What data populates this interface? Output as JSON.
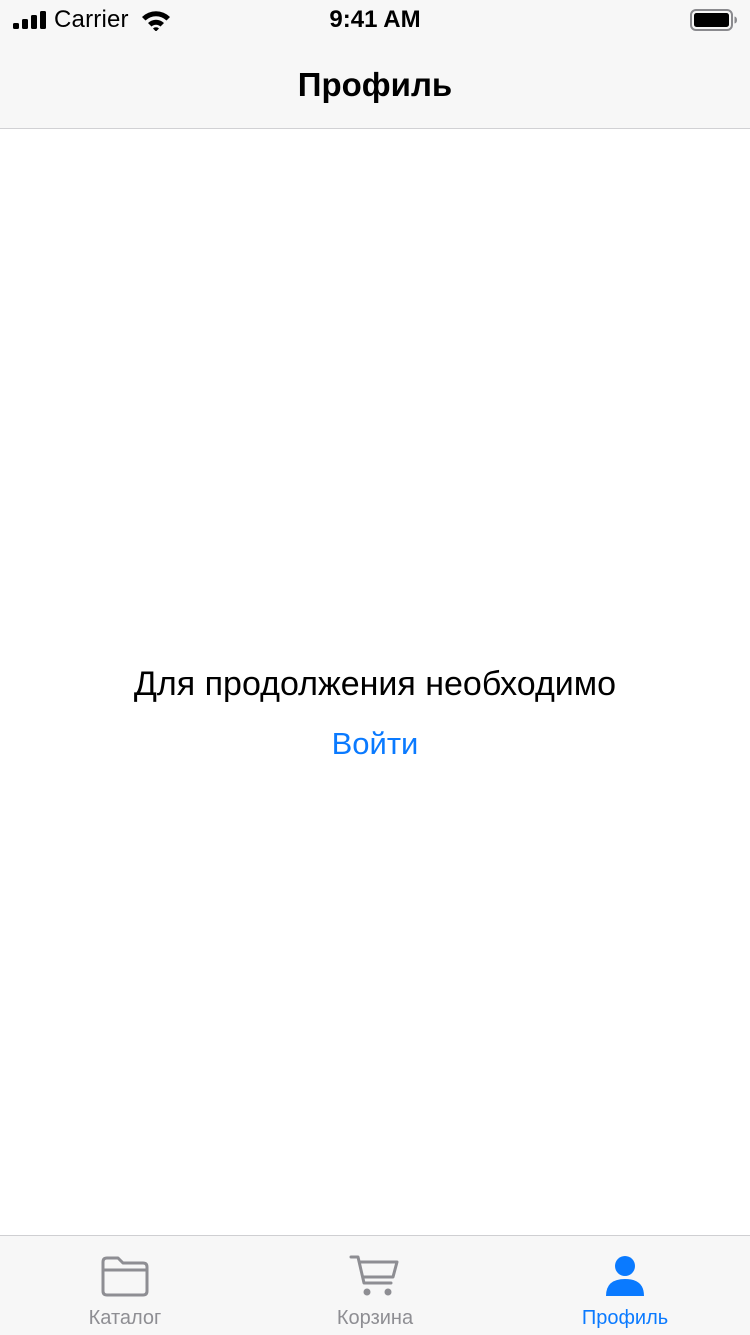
{
  "status_bar": {
    "carrier": "Carrier",
    "time": "9:41 AM",
    "icons": [
      "signal-icon",
      "wifi-icon",
      "battery-icon"
    ]
  },
  "nav": {
    "title": "Профиль"
  },
  "content": {
    "message": "Для продолжения необходимо",
    "login_label": "Войти"
  },
  "tab_bar": {
    "tabs": [
      {
        "label": "Каталог",
        "icon": "folder-icon",
        "active": false
      },
      {
        "label": "Корзина",
        "icon": "cart-icon",
        "active": false
      },
      {
        "label": "Профиль",
        "icon": "person-icon",
        "active": true
      }
    ]
  },
  "colors": {
    "accent": "#0a7aff",
    "inactive": "#8e8e93",
    "bar_background": "#f7f7f7"
  }
}
